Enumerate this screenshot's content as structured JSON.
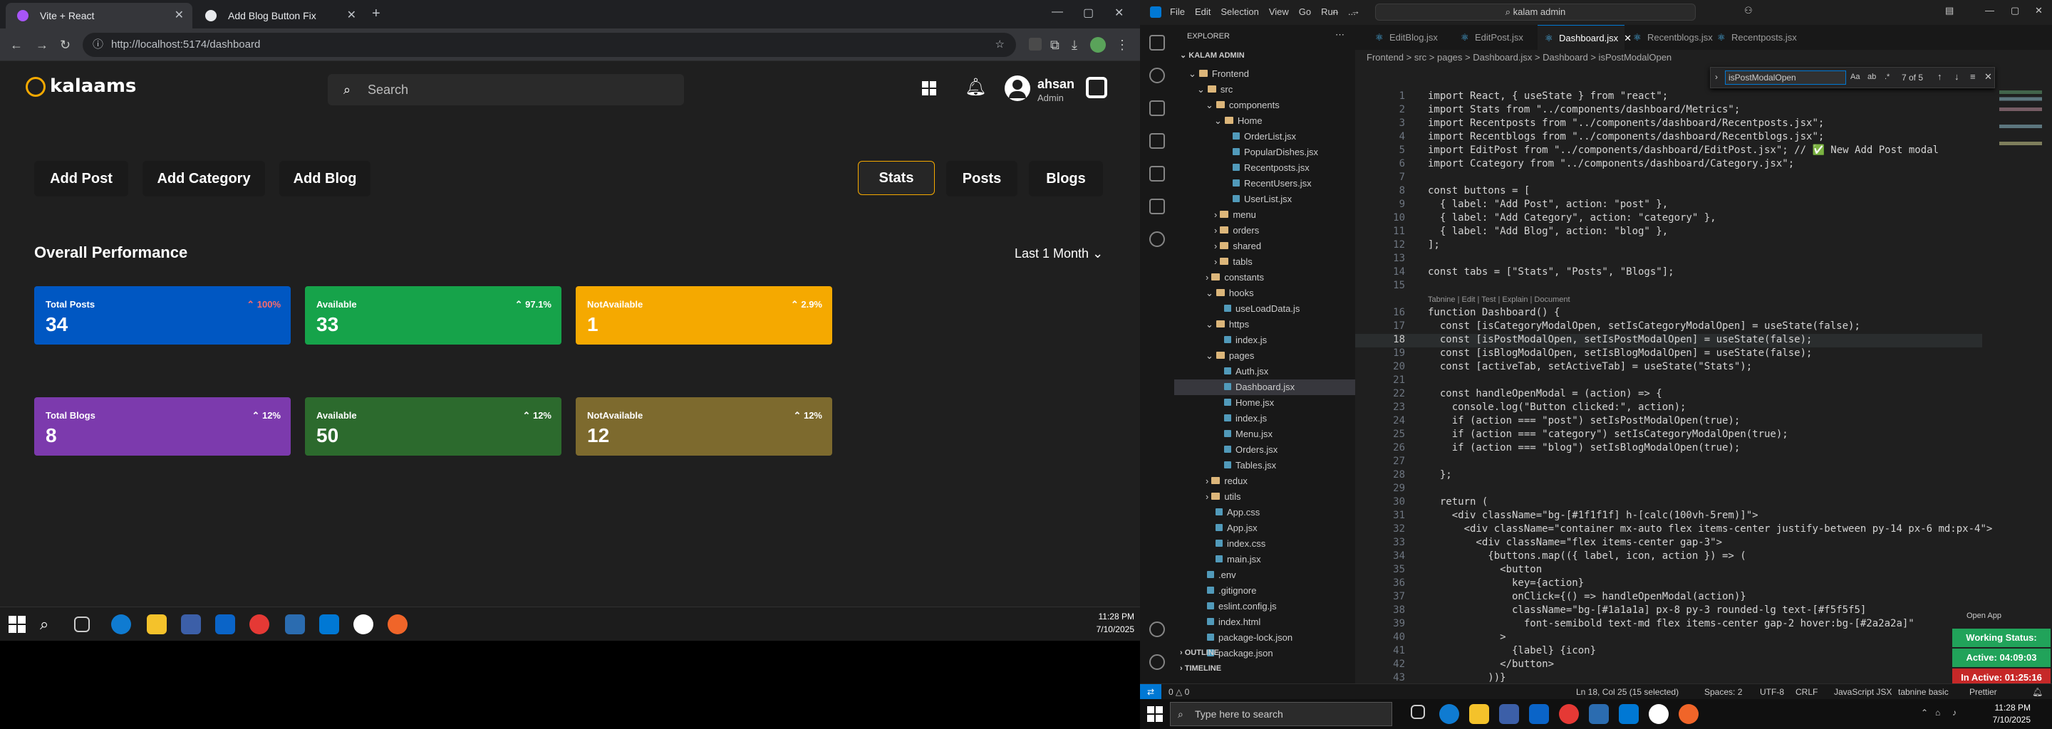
{
  "browser": {
    "tabs": [
      {
        "label": "Vite + React"
      },
      {
        "label": "Add Blog Button Fix"
      }
    ],
    "url": "http://localhost:5174/dashboard"
  },
  "app": {
    "logo": "kalaams",
    "search_placeholder": "Search",
    "user": {
      "name": "ahsan",
      "role": "Admin"
    },
    "actions": [
      "Add Post",
      "Add Category",
      "Add Blog"
    ],
    "tabs": [
      "Stats",
      "Posts",
      "Blogs"
    ],
    "section_title": "Overall Performance",
    "period": "Last 1 Month",
    "cards": [
      {
        "label": "Total Posts",
        "value": "34",
        "pct": "100%",
        "color": "#0057c2"
      },
      {
        "label": "Available",
        "value": "33",
        "pct": "97.1%",
        "color": "#16a34a"
      },
      {
        "label": "NotAvailable",
        "value": "1",
        "pct": "2.9%",
        "color": "#f5a900"
      },
      {
        "label": "Total Blogs",
        "value": "8",
        "pct": "12%",
        "color": "#7c3aad"
      },
      {
        "label": "Available",
        "value": "50",
        "pct": "12%",
        "color": "#2c6a2d"
      },
      {
        "label": "NotAvailable",
        "value": "12",
        "pct": "12%",
        "color": "#7d6a2e"
      }
    ]
  },
  "taskbar_left": {
    "time": "11:28 PM",
    "date": "7/10/2025"
  },
  "vscode": {
    "menu": [
      "File",
      "Edit",
      "Selection",
      "View",
      "Go",
      "Run",
      "..."
    ],
    "search": "kalam admin",
    "explorer_title": "EXPLORER",
    "root": "KALAM ADMIN",
    "tree": [
      {
        "label": "Frontend",
        "depth": 1,
        "type": "folder"
      },
      {
        "label": "src",
        "depth": 2,
        "type": "folder"
      },
      {
        "label": "components",
        "depth": 3,
        "type": "folder"
      },
      {
        "label": "Home",
        "depth": 4,
        "type": "folder"
      },
      {
        "label": "OrderList.jsx",
        "depth": 5,
        "type": "file"
      },
      {
        "label": "PopularDishes.jsx",
        "depth": 5,
        "type": "file"
      },
      {
        "label": "Recentposts.jsx",
        "depth": 5,
        "type": "file"
      },
      {
        "label": "RecentUsers.jsx",
        "depth": 5,
        "type": "file"
      },
      {
        "label": "UserList.jsx",
        "depth": 5,
        "type": "file"
      },
      {
        "label": "menu",
        "depth": 4,
        "type": "folder"
      },
      {
        "label": "orders",
        "depth": 4,
        "type": "folder"
      },
      {
        "label": "shared",
        "depth": 4,
        "type": "folder"
      },
      {
        "label": "tabls",
        "depth": 4,
        "type": "folder"
      },
      {
        "label": "constants",
        "depth": 3,
        "type": "folder"
      },
      {
        "label": "hooks",
        "depth": 3,
        "type": "folder"
      },
      {
        "label": "useLoadData.js",
        "depth": 4,
        "type": "file"
      },
      {
        "label": "https",
        "depth": 3,
        "type": "folder"
      },
      {
        "label": "index.js",
        "depth": 4,
        "type": "file"
      },
      {
        "label": "pages",
        "depth": 3,
        "type": "folder"
      },
      {
        "label": "Auth.jsx",
        "depth": 4,
        "type": "file"
      },
      {
        "label": "Dashboard.jsx",
        "depth": 4,
        "type": "file",
        "selected": true
      },
      {
        "label": "Home.jsx",
        "depth": 4,
        "type": "file"
      },
      {
        "label": "index.js",
        "depth": 4,
        "type": "file"
      },
      {
        "label": "Menu.jsx",
        "depth": 4,
        "type": "file"
      },
      {
        "label": "Orders.jsx",
        "depth": 4,
        "type": "file"
      },
      {
        "label": "Tables.jsx",
        "depth": 4,
        "type": "file"
      },
      {
        "label": "redux",
        "depth": 3,
        "type": "folder"
      },
      {
        "label": "utils",
        "depth": 3,
        "type": "folder"
      },
      {
        "label": "App.css",
        "depth": 3,
        "type": "file"
      },
      {
        "label": "App.jsx",
        "depth": 3,
        "type": "file"
      },
      {
        "label": "index.css",
        "depth": 3,
        "type": "file"
      },
      {
        "label": "main.jsx",
        "depth": 3,
        "type": "file"
      },
      {
        "label": ".env",
        "depth": 2,
        "type": "file"
      },
      {
        "label": ".gitignore",
        "depth": 2,
        "type": "file"
      },
      {
        "label": "eslint.config.js",
        "depth": 2,
        "type": "file"
      },
      {
        "label": "index.html",
        "depth": 2,
        "type": "file"
      },
      {
        "label": "package-lock.json",
        "depth": 2,
        "type": "file"
      },
      {
        "label": "package.json",
        "depth": 2,
        "type": "file"
      }
    ],
    "outline": "OUTLINE",
    "timeline": "TIMELINE",
    "editor_tabs": [
      "EditBlog.jsx",
      "EditPost.jsx",
      "Dashboard.jsx",
      "Recentblogs.jsx",
      "Recentposts.jsx"
    ],
    "breadcrumb": "Frontend > src > pages > Dashboard.jsx > Dashboard > isPostModalOpen",
    "find": {
      "query": "isPostModalOpen",
      "result": "7 of 5"
    },
    "codelens": "Tabnine | Edit | Test | Explain | Document",
    "code": [
      "import React, { useState } from \"react\";",
      "import Stats from \"../components/dashboard/Metrics\";",
      "import Recentposts from \"../components/dashboard/Recentposts.jsx\";",
      "import Recentblogs from \"../components/dashboard/Recentblogs.jsx\";",
      "import EditPost from \"../components/dashboard/EditPost.jsx\"; // ✅ New Add Post modal",
      "import Ccategory from \"../components/dashboard/Category.jsx\";",
      "",
      "const buttons = [",
      "  { label: \"Add Post\", action: \"post\" },",
      "  { label: \"Add Category\", action: \"category\" },",
      "  { label: \"Add Blog\", action: \"blog\" },",
      "];",
      "",
      "const tabs = [\"Stats\", \"Posts\", \"Blogs\"];",
      "",
      "function Dashboard() {",
      "  const [isCategoryModalOpen, setIsCategoryModalOpen] = useState(false);",
      "  const [isPostModalOpen, setIsPostModalOpen] = useState(false);",
      "  const [isBlogModalOpen, setIsBlogModalOpen] = useState(false);",
      "  const [activeTab, setActiveTab] = useState(\"Stats\");",
      "",
      "  const handleOpenModal = (action) => {",
      "    console.log(\"Button clicked:\", action);",
      "    if (action === \"post\") setIsPostModalOpen(true);",
      "    if (action === \"category\") setIsCategoryModalOpen(true);",
      "    if (action === \"blog\") setIsBlogModalOpen(true);",
      "",
      "  };",
      "",
      "  return (",
      "    <div className=\"bg-[#1f1f1f] h-[calc(100vh-5rem)]\">",
      "      <div className=\"container mx-auto flex items-center justify-between py-14 px-6 md:px-4\">",
      "        <div className=\"flex items-center gap-3\">",
      "          {buttons.map(({ label, icon, action }) => (",
      "            <button",
      "              key={action}",
      "              onClick={() => handleOpenModal(action)}",
      "              className=\"bg-[#1a1a1a] px-8 py-3 rounded-lg text-[#f5f5f5]",
      "                font-semibold text-md flex items-center gap-2 hover:bg-[#2a2a2a]\"",
      "            >",
      "              {label} {icon}",
      "            </button>",
      "          ))}"
    ],
    "status": {
      "left": "0 △ 0",
      "position": "Ln 18, Col 25 (15 selected)",
      "spaces": "Spaces: 2",
      "enc": "UTF-8",
      "eol": "CRLF",
      "lang": "JavaScript JSX",
      "ext": "tabnine basic",
      "prettier": "Prettier"
    },
    "badges": [
      {
        "label": "Working Status: Active",
        "color": "#21a35a"
      },
      {
        "label": "Active: 04:09:03",
        "color": "#21a35a"
      },
      {
        "label": "In Active: 01:25:16",
        "color": "#c62828"
      }
    ],
    "open_app": "Open App"
  },
  "taskbar_right": {
    "search": "Type here to search",
    "time": "11:28 PM",
    "date": "7/10/2025"
  }
}
